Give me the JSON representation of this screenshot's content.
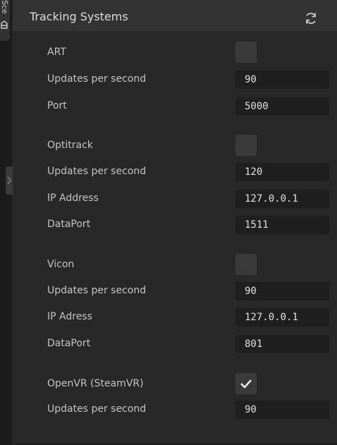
{
  "side_tab": {
    "label": "Sce"
  },
  "panel": {
    "title": "Tracking Systems",
    "refresh_icon": "refresh-icon"
  },
  "systems": [
    {
      "name": "ART",
      "enabled": false,
      "fields": [
        {
          "label": "Updates per second",
          "value": "90"
        },
        {
          "label": "Port",
          "value": "5000"
        }
      ]
    },
    {
      "name": "Optitrack",
      "enabled": false,
      "fields": [
        {
          "label": "Updates per second",
          "value": "120"
        },
        {
          "label": "IP Address",
          "value": "127.0.0.1"
        },
        {
          "label": "DataPort",
          "value": "1511"
        }
      ]
    },
    {
      "name": "Vicon",
      "enabled": false,
      "fields": [
        {
          "label": "Updates per second",
          "value": "90"
        },
        {
          "label": "IP Adress",
          "value": "127.0.0.1"
        },
        {
          "label": "DataPort",
          "value": "801"
        }
      ]
    },
    {
      "name": "OpenVR (SteamVR)",
      "enabled": true,
      "fields": [
        {
          "label": "Updates per second",
          "value": "90"
        }
      ]
    }
  ]
}
